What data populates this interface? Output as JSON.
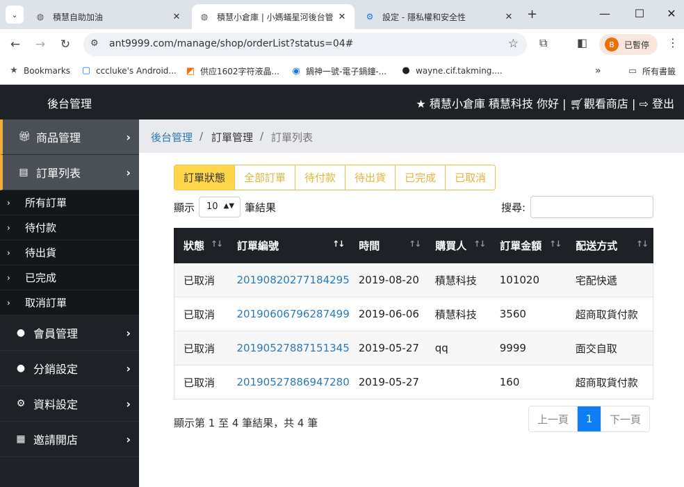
{
  "browser": {
    "tabs": [
      {
        "title": "積慧自助加油",
        "favicon": "globe-icon"
      },
      {
        "title": "積慧小倉庫 | 小媽蟻星河後台管",
        "favicon": "globe-icon"
      },
      {
        "title": "設定 - 隱私權和安全性",
        "favicon": "gear-icon"
      }
    ],
    "url": "ant9999.com/manage/shop/orderList?status=04#",
    "profile_initial": "B",
    "profile_label": "已暫停",
    "bookmarks": [
      {
        "label": "Bookmarks",
        "icon": "star-icon"
      },
      {
        "label": "cccluke's Android...",
        "icon": "page-icon"
      },
      {
        "label": "供应1602字符液晶...",
        "icon": "alibaba-icon"
      },
      {
        "label": "鍋神一號-電子鍋鐘-...",
        "icon": "signal-icon"
      },
      {
        "label": "wayne.cif.takming....",
        "icon": "github-icon"
      }
    ],
    "all_bookmarks": "所有書籤"
  },
  "app": {
    "brand": "後台管理",
    "user_text": "積慧小倉庫 積慧科技 你好 |",
    "shop_link": "觀看商店",
    "logout": "登出"
  },
  "sidebar": {
    "sections": [
      {
        "label": "商品管理",
        "icon": "gift-icon"
      },
      {
        "label": "訂單列表",
        "icon": "file-icon"
      }
    ],
    "order_sub": [
      "所有訂單",
      "待付款",
      "待出貨",
      "已完成",
      "取消訂單"
    ],
    "lower": [
      {
        "label": "會員管理",
        "icon": "user-icon"
      },
      {
        "label": "分銷設定",
        "icon": "user-icon"
      },
      {
        "label": "資料設定",
        "icon": "gear-icon"
      },
      {
        "label": "邀請開店",
        "icon": "qrcode-icon"
      }
    ]
  },
  "breadcrumb": {
    "root": "後台管理",
    "mid": "訂單管理",
    "current": "訂單列表",
    "sep": "/"
  },
  "filters": [
    "訂單狀態",
    "全部訂單",
    "待付款",
    "待出貨",
    "已完成",
    "已取消"
  ],
  "length": {
    "prefix": "顯示",
    "value": "10",
    "suffix": "筆結果"
  },
  "search_label": "搜尋:",
  "table": {
    "columns": [
      "狀態",
      "訂單編號",
      "時間",
      "購買人",
      "訂單金額",
      "配送方式"
    ],
    "rows": [
      {
        "status": "已取消",
        "order_no": "20190820277184295",
        "date": "2019-08-20",
        "buyer": "積慧科技",
        "amount": "101020",
        "shipping": "宅配快遞"
      },
      {
        "status": "已取消",
        "order_no": "20190606796287499",
        "date": "2019-06-06",
        "buyer": "積慧科技",
        "amount": "3560",
        "shipping": "超商取貨付款"
      },
      {
        "status": "已取消",
        "order_no": "20190527887151345",
        "date": "2019-05-27",
        "buyer": "qq",
        "amount": "9999",
        "shipping": "面交自取"
      },
      {
        "status": "已取消",
        "order_no": "20190527886947280",
        "date": "2019-05-27",
        "buyer": "",
        "amount": "160",
        "shipping": "超商取貨付款"
      }
    ]
  },
  "info": "顯示第 1 至 4 筆結果，共 4 筆",
  "pager": {
    "prev": "上一頁",
    "page": "1",
    "next": "下一頁"
  }
}
